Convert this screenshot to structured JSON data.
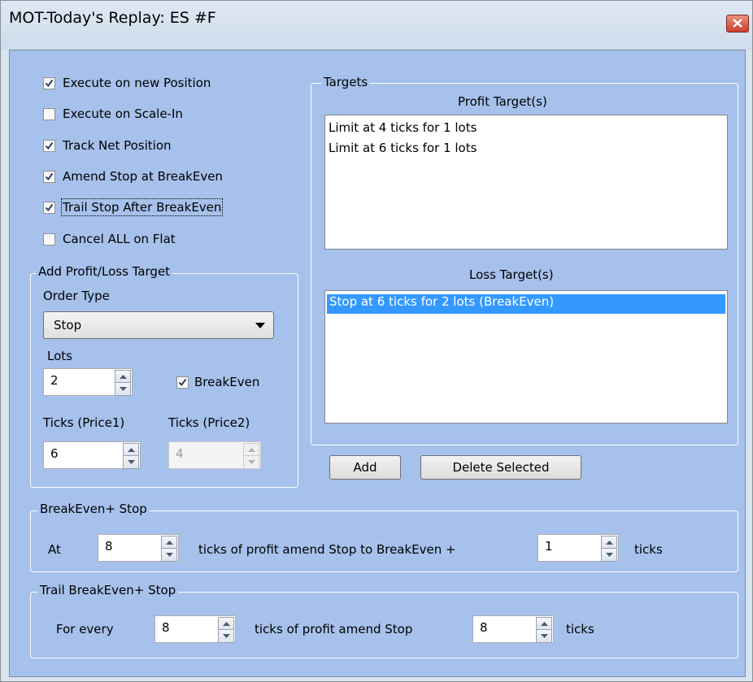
{
  "window": {
    "title": "MOT-Today's Replay: ES #F"
  },
  "options": {
    "execute_new_position": {
      "label": "Execute on new Position",
      "checked": true
    },
    "execute_scale_in": {
      "label": "Execute on Scale-In",
      "checked": false
    },
    "track_net_position": {
      "label": "Track Net Position",
      "checked": true
    },
    "amend_stop_breakeven": {
      "label": "Amend Stop at BreakEven",
      "checked": true
    },
    "trail_stop_after_breakeven": {
      "label": "Trail Stop After BreakEven",
      "checked": true
    },
    "cancel_all_on_flat": {
      "label": "Cancel ALL on Flat",
      "checked": false
    }
  },
  "add_target": {
    "legend": "Add Profit/Loss Target",
    "order_type_label": "Order Type",
    "order_type_value": "Stop",
    "lots_label": "Lots",
    "lots_value": "2",
    "breakeven_label": "BreakEven",
    "breakeven_checked": true,
    "ticks1_label": "Ticks (Price1)",
    "ticks1_value": "6",
    "ticks2_label": "Ticks (Price2)",
    "ticks2_value": "4"
  },
  "targets": {
    "legend": "Targets",
    "profit_header": "Profit Target(s)",
    "profit_items": [
      "Limit at 4 ticks for 1 lots",
      "Limit at 6 ticks for 1 lots"
    ],
    "loss_header": "Loss Target(s)",
    "loss_items": [
      "Stop at 6 ticks for 2 lots (BreakEven)"
    ]
  },
  "buttons": {
    "add": "Add",
    "delete_selected": "Delete Selected"
  },
  "breakeven_stop": {
    "legend": "BreakEven+ Stop",
    "at_label": "At",
    "ticks_value": "8",
    "middle_text": "ticks of profit amend Stop to BreakEven +",
    "plus_value": "1",
    "end_text": "ticks"
  },
  "trail_stop": {
    "legend": "Trail BreakEven+ Stop",
    "for_every_label": "For every",
    "ticks_value": "8",
    "middle_text": "ticks of profit amend Stop",
    "amend_value": "8",
    "end_text": "ticks"
  },
  "colors": {
    "panel": "#a6c1eb",
    "selection": "#3399ff",
    "close_button": "#c9402c"
  }
}
